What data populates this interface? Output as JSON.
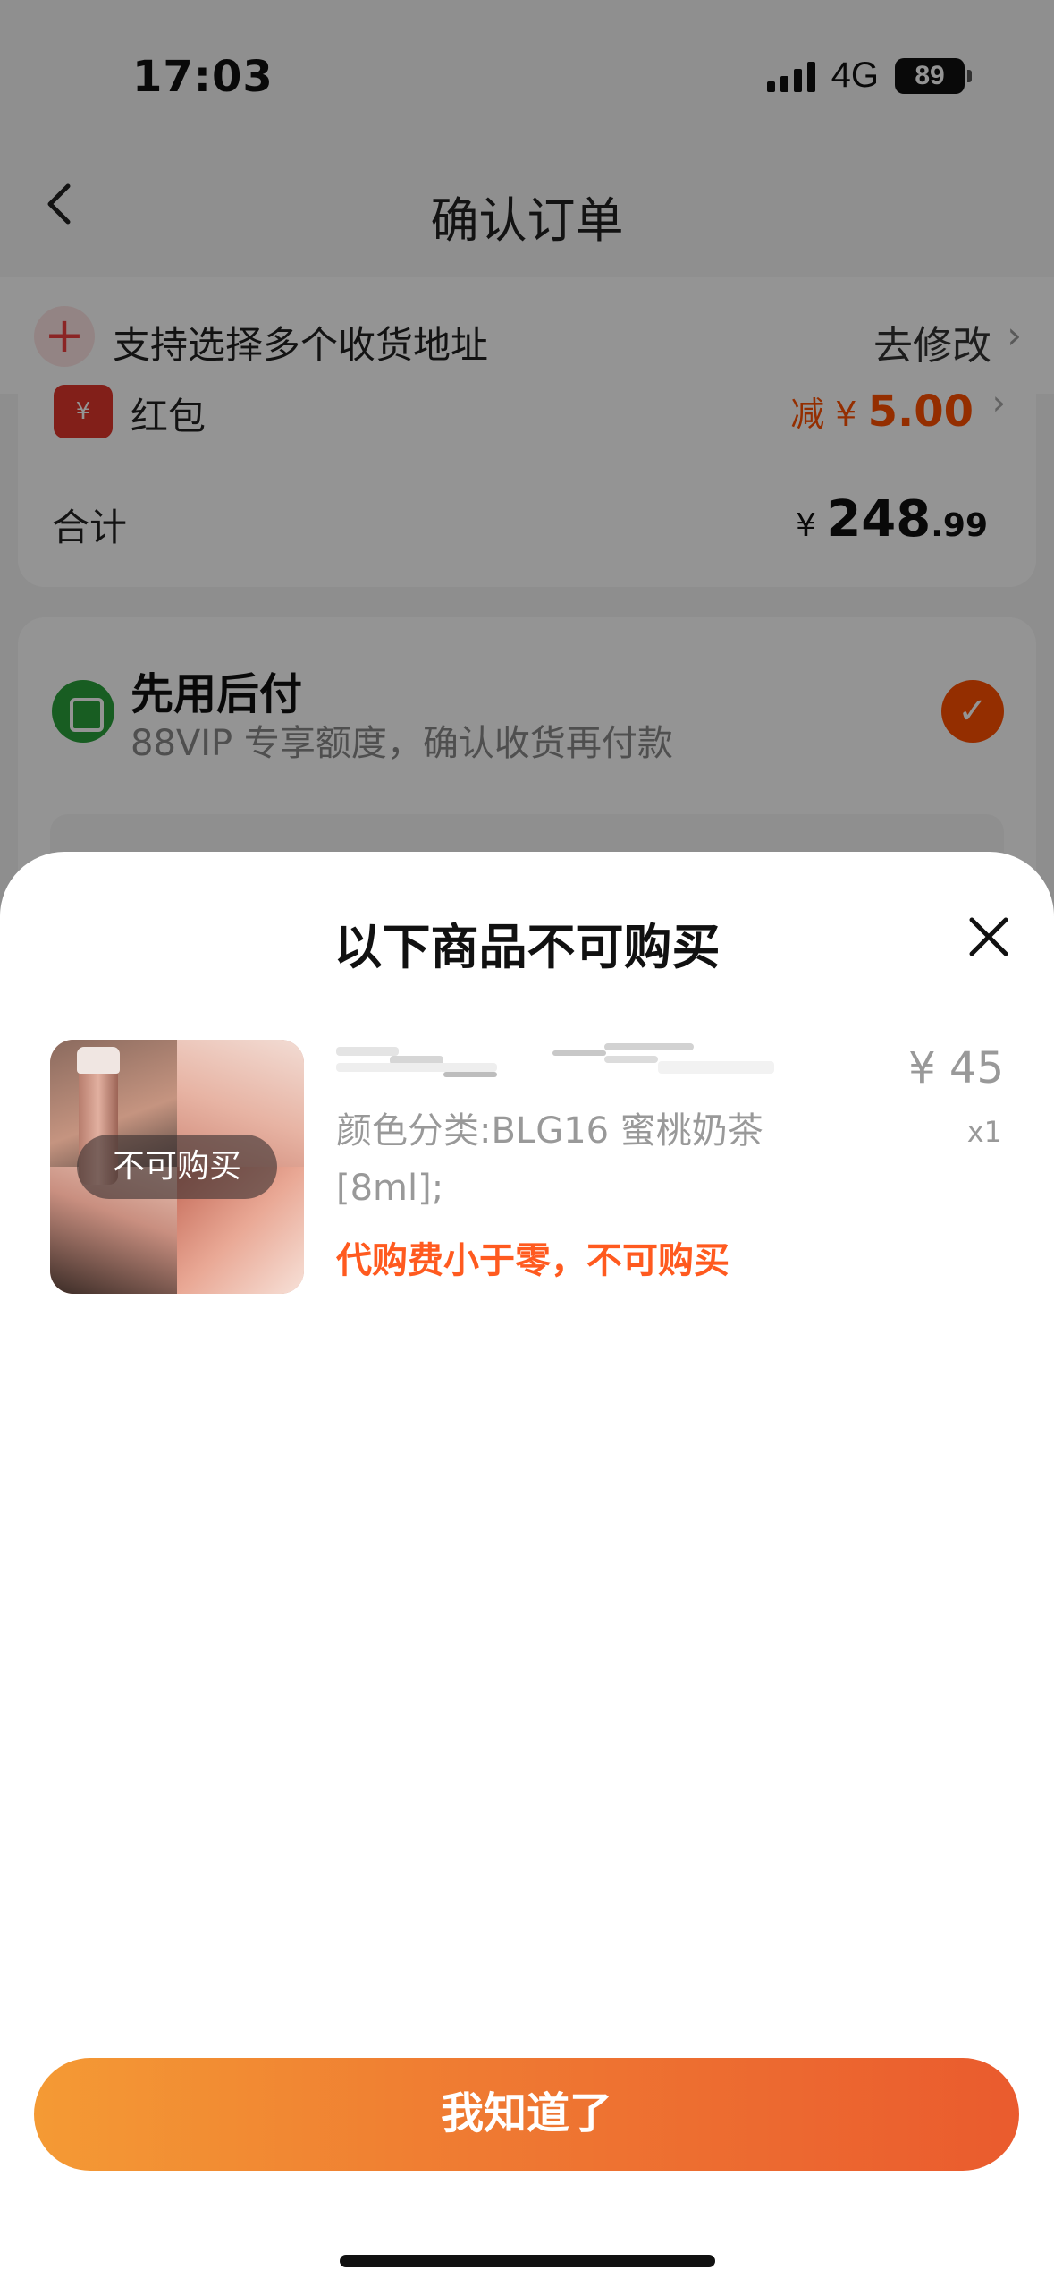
{
  "status_bar": {
    "time": "17:03",
    "network": "4G",
    "battery": "89"
  },
  "nav": {
    "title": "确认订单"
  },
  "address": {
    "text": "支持选择多个收货地址",
    "modify": "去修改"
  },
  "summary": {
    "hongbao_icon": "¥",
    "hongbao_label": "红包",
    "hongbao_prefix": "减 ¥ ",
    "hongbao_amount": "5.00",
    "total_label": "合计",
    "total_currency": "¥ ",
    "total_integer": "248",
    "total_decimal": ".99"
  },
  "pay_later": {
    "title": "先用后付",
    "subtitle": "88VIP 专享额度，确认收货再付款",
    "selected": true
  },
  "sheet": {
    "title": "以下商品不可购买",
    "item": {
      "tag": "不可购买",
      "price": "¥ 45",
      "quantity": "x1",
      "spec": "颜色分类:BLG16 蜜桃奶茶 [8ml];",
      "reason": "代购费小于零，不可购买"
    },
    "confirm": "我知道了"
  },
  "icons": {
    "back": "chevron-left-icon",
    "close": "close-icon",
    "add": "plus-icon",
    "check": "check-icon"
  },
  "colors": {
    "accent": "#ff5000",
    "button_start": "#f49a34",
    "button_end": "#ea5b2e",
    "pay_green": "#2aa13c"
  }
}
